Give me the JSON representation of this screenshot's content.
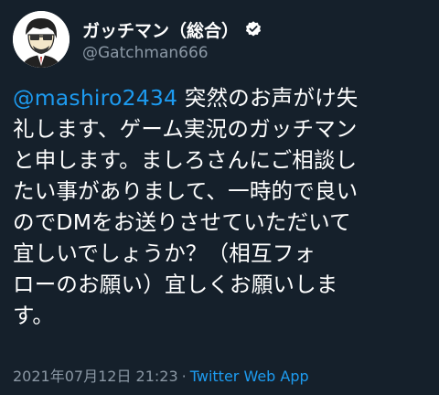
{
  "author": {
    "display_name": "ガッチマン（総合）",
    "handle": "@Gatchman666"
  },
  "tweet": {
    "mention": "@mashiro2434",
    "lines": [
      " 突然のお声がけ失",
      "礼します、ゲーム実況のガッチマン",
      "と申します。ましろさんにご相談し",
      "たい事がありまして、一時的で良い",
      "のでDMをお送りさせていただいて",
      "宜しいでしょうか？（相互フォ",
      "ローのお願い）宜しくお願いしま",
      "す。"
    ]
  },
  "meta": {
    "timestamp": "2021年07月12日 21:23",
    "separator": "·",
    "source": "Twitter Web App"
  },
  "colors": {
    "background": "#15202b",
    "accent": "#1d9bf0",
    "secondary_text": "#8b98a5"
  }
}
